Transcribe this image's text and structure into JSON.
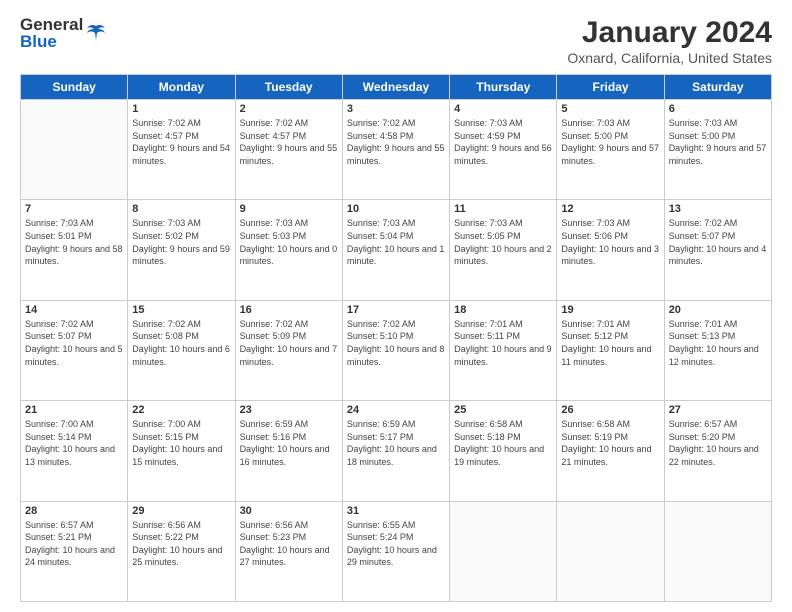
{
  "header": {
    "logo_line1": "General",
    "logo_line2": "Blue",
    "title": "January 2024",
    "subtitle": "Oxnard, California, United States"
  },
  "weekdays": [
    "Sunday",
    "Monday",
    "Tuesday",
    "Wednesday",
    "Thursday",
    "Friday",
    "Saturday"
  ],
  "weeks": [
    [
      {
        "day": "",
        "sunrise": "",
        "sunset": "",
        "daylight": ""
      },
      {
        "day": "1",
        "sunrise": "Sunrise: 7:02 AM",
        "sunset": "Sunset: 4:57 PM",
        "daylight": "Daylight: 9 hours and 54 minutes."
      },
      {
        "day": "2",
        "sunrise": "Sunrise: 7:02 AM",
        "sunset": "Sunset: 4:57 PM",
        "daylight": "Daylight: 9 hours and 55 minutes."
      },
      {
        "day": "3",
        "sunrise": "Sunrise: 7:02 AM",
        "sunset": "Sunset: 4:58 PM",
        "daylight": "Daylight: 9 hours and 55 minutes."
      },
      {
        "day": "4",
        "sunrise": "Sunrise: 7:03 AM",
        "sunset": "Sunset: 4:59 PM",
        "daylight": "Daylight: 9 hours and 56 minutes."
      },
      {
        "day": "5",
        "sunrise": "Sunrise: 7:03 AM",
        "sunset": "Sunset: 5:00 PM",
        "daylight": "Daylight: 9 hours and 57 minutes."
      },
      {
        "day": "6",
        "sunrise": "Sunrise: 7:03 AM",
        "sunset": "Sunset: 5:00 PM",
        "daylight": "Daylight: 9 hours and 57 minutes."
      }
    ],
    [
      {
        "day": "7",
        "sunrise": "Sunrise: 7:03 AM",
        "sunset": "Sunset: 5:01 PM",
        "daylight": "Daylight: 9 hours and 58 minutes."
      },
      {
        "day": "8",
        "sunrise": "Sunrise: 7:03 AM",
        "sunset": "Sunset: 5:02 PM",
        "daylight": "Daylight: 9 hours and 59 minutes."
      },
      {
        "day": "9",
        "sunrise": "Sunrise: 7:03 AM",
        "sunset": "Sunset: 5:03 PM",
        "daylight": "Daylight: 10 hours and 0 minutes."
      },
      {
        "day": "10",
        "sunrise": "Sunrise: 7:03 AM",
        "sunset": "Sunset: 5:04 PM",
        "daylight": "Daylight: 10 hours and 1 minute."
      },
      {
        "day": "11",
        "sunrise": "Sunrise: 7:03 AM",
        "sunset": "Sunset: 5:05 PM",
        "daylight": "Daylight: 10 hours and 2 minutes."
      },
      {
        "day": "12",
        "sunrise": "Sunrise: 7:03 AM",
        "sunset": "Sunset: 5:06 PM",
        "daylight": "Daylight: 10 hours and 3 minutes."
      },
      {
        "day": "13",
        "sunrise": "Sunrise: 7:02 AM",
        "sunset": "Sunset: 5:07 PM",
        "daylight": "Daylight: 10 hours and 4 minutes."
      }
    ],
    [
      {
        "day": "14",
        "sunrise": "Sunrise: 7:02 AM",
        "sunset": "Sunset: 5:07 PM",
        "daylight": "Daylight: 10 hours and 5 minutes."
      },
      {
        "day": "15",
        "sunrise": "Sunrise: 7:02 AM",
        "sunset": "Sunset: 5:08 PM",
        "daylight": "Daylight: 10 hours and 6 minutes."
      },
      {
        "day": "16",
        "sunrise": "Sunrise: 7:02 AM",
        "sunset": "Sunset: 5:09 PM",
        "daylight": "Daylight: 10 hours and 7 minutes."
      },
      {
        "day": "17",
        "sunrise": "Sunrise: 7:02 AM",
        "sunset": "Sunset: 5:10 PM",
        "daylight": "Daylight: 10 hours and 8 minutes."
      },
      {
        "day": "18",
        "sunrise": "Sunrise: 7:01 AM",
        "sunset": "Sunset: 5:11 PM",
        "daylight": "Daylight: 10 hours and 9 minutes."
      },
      {
        "day": "19",
        "sunrise": "Sunrise: 7:01 AM",
        "sunset": "Sunset: 5:12 PM",
        "daylight": "Daylight: 10 hours and 11 minutes."
      },
      {
        "day": "20",
        "sunrise": "Sunrise: 7:01 AM",
        "sunset": "Sunset: 5:13 PM",
        "daylight": "Daylight: 10 hours and 12 minutes."
      }
    ],
    [
      {
        "day": "21",
        "sunrise": "Sunrise: 7:00 AM",
        "sunset": "Sunset: 5:14 PM",
        "daylight": "Daylight: 10 hours and 13 minutes."
      },
      {
        "day": "22",
        "sunrise": "Sunrise: 7:00 AM",
        "sunset": "Sunset: 5:15 PM",
        "daylight": "Daylight: 10 hours and 15 minutes."
      },
      {
        "day": "23",
        "sunrise": "Sunrise: 6:59 AM",
        "sunset": "Sunset: 5:16 PM",
        "daylight": "Daylight: 10 hours and 16 minutes."
      },
      {
        "day": "24",
        "sunrise": "Sunrise: 6:59 AM",
        "sunset": "Sunset: 5:17 PM",
        "daylight": "Daylight: 10 hours and 18 minutes."
      },
      {
        "day": "25",
        "sunrise": "Sunrise: 6:58 AM",
        "sunset": "Sunset: 5:18 PM",
        "daylight": "Daylight: 10 hours and 19 minutes."
      },
      {
        "day": "26",
        "sunrise": "Sunrise: 6:58 AM",
        "sunset": "Sunset: 5:19 PM",
        "daylight": "Daylight: 10 hours and 21 minutes."
      },
      {
        "day": "27",
        "sunrise": "Sunrise: 6:57 AM",
        "sunset": "Sunset: 5:20 PM",
        "daylight": "Daylight: 10 hours and 22 minutes."
      }
    ],
    [
      {
        "day": "28",
        "sunrise": "Sunrise: 6:57 AM",
        "sunset": "Sunset: 5:21 PM",
        "daylight": "Daylight: 10 hours and 24 minutes."
      },
      {
        "day": "29",
        "sunrise": "Sunrise: 6:56 AM",
        "sunset": "Sunset: 5:22 PM",
        "daylight": "Daylight: 10 hours and 25 minutes."
      },
      {
        "day": "30",
        "sunrise": "Sunrise: 6:56 AM",
        "sunset": "Sunset: 5:23 PM",
        "daylight": "Daylight: 10 hours and 27 minutes."
      },
      {
        "day": "31",
        "sunrise": "Sunrise: 6:55 AM",
        "sunset": "Sunset: 5:24 PM",
        "daylight": "Daylight: 10 hours and 29 minutes."
      },
      {
        "day": "",
        "sunrise": "",
        "sunset": "",
        "daylight": ""
      },
      {
        "day": "",
        "sunrise": "",
        "sunset": "",
        "daylight": ""
      },
      {
        "day": "",
        "sunrise": "",
        "sunset": "",
        "daylight": ""
      }
    ]
  ]
}
